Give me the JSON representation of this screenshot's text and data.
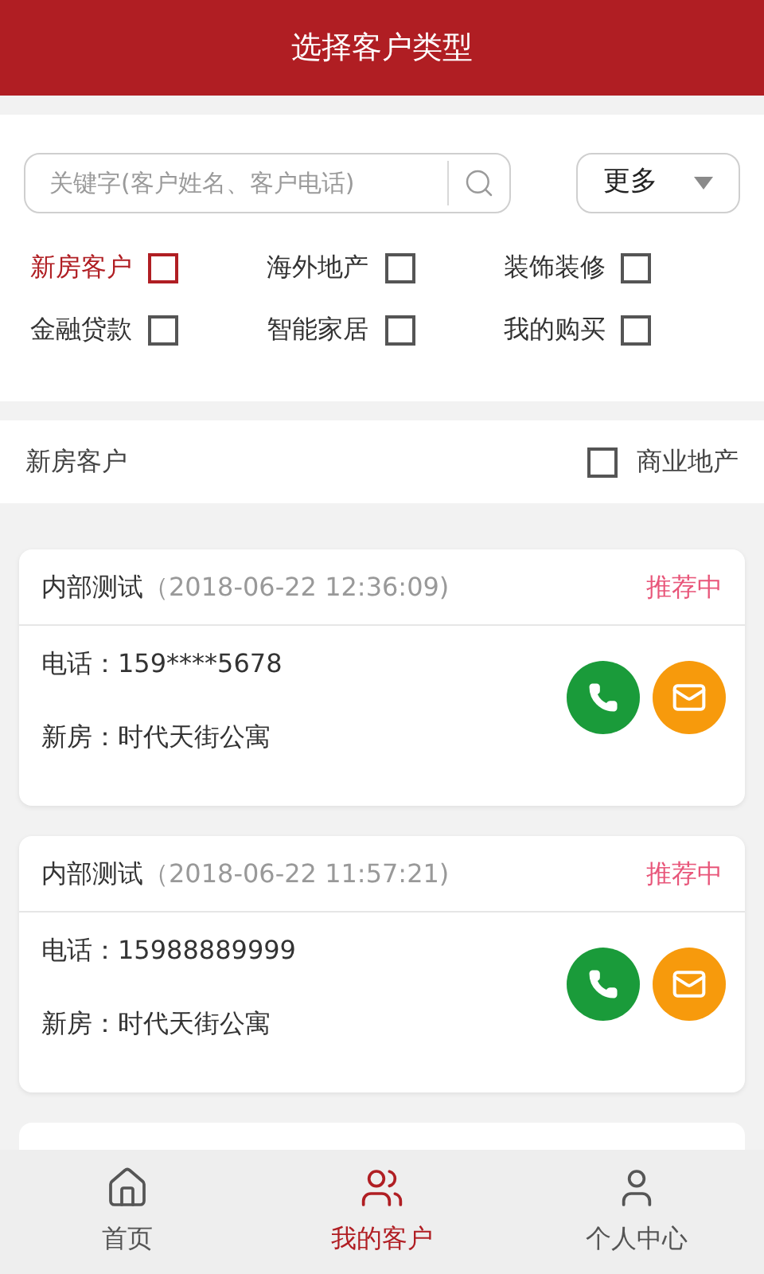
{
  "header": {
    "title": "选择客户类型"
  },
  "search": {
    "placeholder": "关键字(客户姓名、客户电话)"
  },
  "more_button": {
    "label": "更多"
  },
  "categories": [
    {
      "label": "新房客户",
      "selected": true,
      "checked": false
    },
    {
      "label": "海外地产",
      "selected": false,
      "checked": false
    },
    {
      "label": "装饰装修",
      "selected": false,
      "checked": false
    },
    {
      "label": "金融贷款",
      "selected": false,
      "checked": false
    },
    {
      "label": "智能家居",
      "selected": false,
      "checked": false
    },
    {
      "label": "我的购买",
      "selected": false,
      "checked": false
    }
  ],
  "sub_filter": {
    "label": "新房客户",
    "option": {
      "label": "商业地产",
      "checked": false
    }
  },
  "customers": [
    {
      "name": "内部测试",
      "time": "（2018-06-22 12:36:09)",
      "status": "推荐中",
      "phone_label": "电话：",
      "phone": "159****5678",
      "property_label": "新房：",
      "property": "时代天街公寓"
    },
    {
      "name": "内部测试",
      "time": "（2018-06-22 11:57:21)",
      "status": "推荐中",
      "phone_label": "电话：",
      "phone": "15988889999",
      "property_label": "新房：",
      "property": "时代天街公寓"
    }
  ],
  "tabs": [
    {
      "label": "首页",
      "kind": "home",
      "selected": false
    },
    {
      "label": "我的客户",
      "kind": "customers",
      "selected": true
    },
    {
      "label": "个人中心",
      "kind": "profile",
      "selected": false
    }
  ]
}
